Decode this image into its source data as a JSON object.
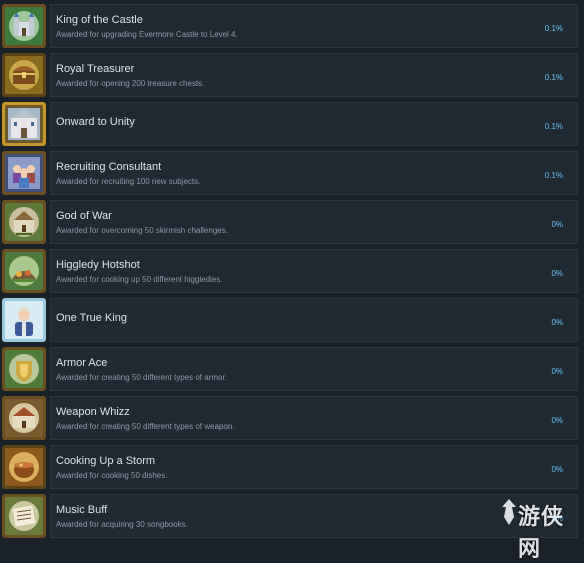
{
  "achievements": [
    {
      "title": "King of the Castle",
      "description": "Awarded for upgrading Evermore Castle to Level 4.",
      "percent": "0.1%",
      "icon": "castle-icon",
      "badge_color": "#3c7a3a"
    },
    {
      "title": "Royal Treasurer",
      "description": "Awarded for opening 200 treasure chests.",
      "percent": "0.1%",
      "icon": "treasure-chest-icon",
      "badge_color": "#8a6a1e"
    },
    {
      "title": "Onward to Unity",
      "description": "",
      "percent": "0.1%",
      "icon": "castle-gate-icon",
      "badge_color": "#6b5a2c"
    },
    {
      "title": "Recruiting Consultant",
      "description": "Awarded for recruiting 100 new subjects.",
      "percent": "0.1%",
      "icon": "recruits-icon",
      "badge_color": "#3f4f7a"
    },
    {
      "title": "God of War",
      "description": "Awarded for overcoming 50 skirmish challenges.",
      "percent": "0%",
      "icon": "war-icon",
      "badge_color": "#5e7a3a"
    },
    {
      "title": "Higgledy Hotshot",
      "description": "Awarded for cooking up 50 different higgledies.",
      "percent": "0%",
      "icon": "higgledy-icon",
      "badge_color": "#4d7a3d"
    },
    {
      "title": "One True King",
      "description": "",
      "percent": "0%",
      "icon": "king-portrait-icon",
      "badge_color": "#5fa0c8"
    },
    {
      "title": "Armor Ace",
      "description": "Awarded for creating 50 different types of armor.",
      "percent": "0%",
      "icon": "armor-icon",
      "badge_color": "#4f7a3a"
    },
    {
      "title": "Weapon Whizz",
      "description": "Awarded for creating 50 different types of weapon.",
      "percent": "0%",
      "icon": "weapon-icon",
      "badge_color": "#7a5a2e"
    },
    {
      "title": "Cooking Up a Storm",
      "description": "Awarded for cooking 50 dishes.",
      "percent": "0%",
      "icon": "cooking-pot-icon",
      "badge_color": "#8a5a1e"
    },
    {
      "title": "Music Buff",
      "description": "Awarded for acquiring 30 songbooks.",
      "percent": "0%",
      "icon": "songbook-icon",
      "badge_color": "#6a7a3a"
    }
  ],
  "watermark": {
    "text": "游侠网",
    "logo_icon": "gamersky-logo-icon"
  },
  "colors": {
    "percent": "#67c1f5",
    "panel": "#202a33",
    "background": "#1b2128"
  }
}
